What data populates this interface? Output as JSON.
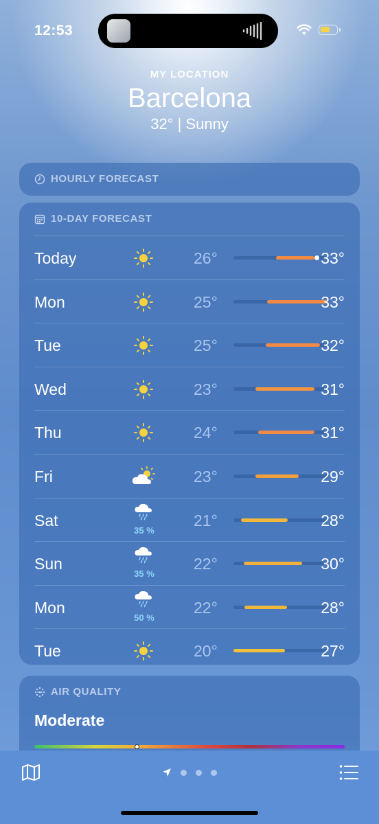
{
  "status_bar": {
    "time": "12:53"
  },
  "header": {
    "location_label": "MY LOCATION",
    "city": "Barcelona",
    "summary": "32°  |  Sunny"
  },
  "hourly": {
    "title": "HOURLY FORECAST"
  },
  "ten_day": {
    "title": "10-DAY FORECAST",
    "rows": [
      {
        "day": "Today",
        "icon": "sun-icon",
        "precip": "",
        "low": "26°",
        "high": "33°",
        "range_start": 0.45,
        "range_end": 0.86,
        "bar_color": "#f08a45",
        "current": true,
        "current_pos": 0.89
      },
      {
        "day": "Mon",
        "icon": "sun-icon",
        "precip": "",
        "low": "25°",
        "high": "33°",
        "range_start": 0.36,
        "range_end": 1.0,
        "bar_color": "#f08a45"
      },
      {
        "day": "Tue",
        "icon": "sun-icon",
        "precip": "",
        "low": "25°",
        "high": "32°",
        "range_start": 0.34,
        "range_end": 0.92,
        "bar_color": "#f08a45"
      },
      {
        "day": "Wed",
        "icon": "sun-icon",
        "precip": "",
        "low": "23°",
        "high": "31°",
        "range_start": 0.23,
        "range_end": 0.86,
        "bar_color": "#f2953e"
      },
      {
        "day": "Thu",
        "icon": "sun-icon",
        "precip": "",
        "low": "24°",
        "high": "31°",
        "range_start": 0.26,
        "range_end": 0.86,
        "bar_color": "#f08a45"
      },
      {
        "day": "Fri",
        "icon": "partly-cloudy-icon",
        "precip": "",
        "low": "23°",
        "high": "29°",
        "range_start": 0.23,
        "range_end": 0.69,
        "bar_color": "#f2a13a"
      },
      {
        "day": "Sat",
        "icon": "rain-cloud-icon",
        "precip": "35 %",
        "low": "21°",
        "high": "28°",
        "range_start": 0.08,
        "range_end": 0.58,
        "bar_color": "#f0b83a"
      },
      {
        "day": "Sun",
        "icon": "rain-cloud-icon",
        "precip": "35 %",
        "low": "22°",
        "high": "30°",
        "range_start": 0.11,
        "range_end": 0.73,
        "bar_color": "#f2b03a"
      },
      {
        "day": "Mon",
        "icon": "rain-cloud-icon",
        "precip": "50 %",
        "low": "22°",
        "high": "28°",
        "range_start": 0.12,
        "range_end": 0.57,
        "bar_color": "#f0b83a"
      },
      {
        "day": "Tue",
        "icon": "sun-icon",
        "precip": "",
        "low": "20°",
        "high": "27°",
        "range_start": 0.0,
        "range_end": 0.55,
        "bar_color": "#f2c13a"
      }
    ]
  },
  "air_quality": {
    "title": "AIR QUALITY",
    "level": "Moderate",
    "index_pos": 0.33
  }
}
